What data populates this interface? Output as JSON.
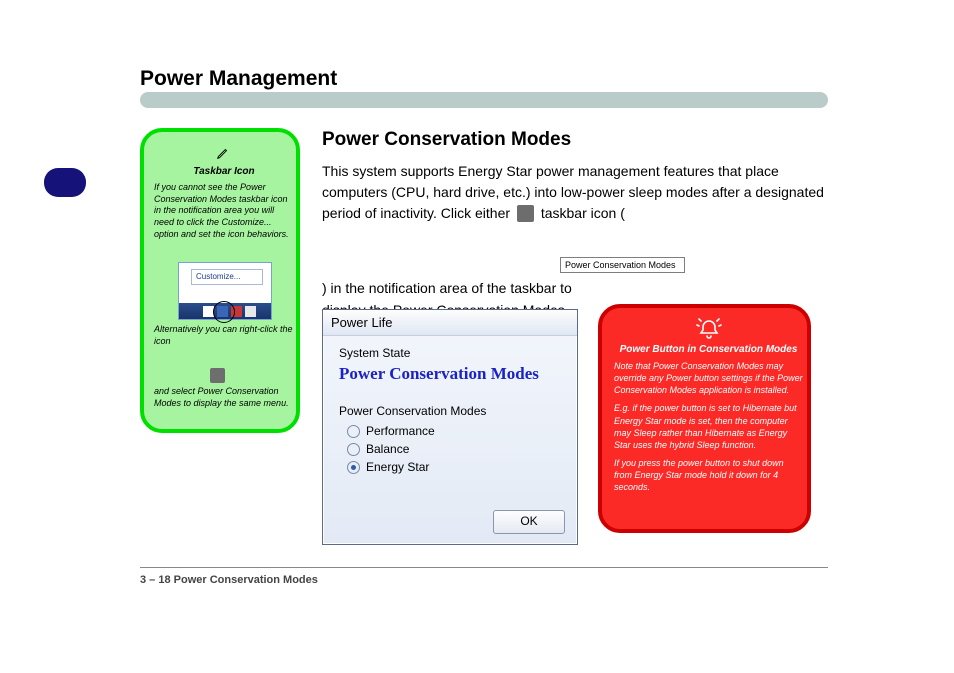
{
  "section_title": "Power Management",
  "green_box": {
    "title": "Taskbar Icon",
    "para1": "If you cannot see the Power Conservation Modes taskbar icon in the notification area you will need to click the Customize... option and set the icon behaviors.",
    "customize_label": "Customize...",
    "para2": "Alternatively you can right-click the icon",
    "para3": "and select Power Conservation Modes to display the same menu."
  },
  "heading": "Power Conservation Modes",
  "paragraph1_before_icon": "This system supports Energy Star power management features that place computers (CPU, hard drive, etc.) into low-power sleep modes after a designated period of inactivity. Click either ",
  "paragraph1_after_icon": " taskbar icon (",
  "paragraph1_after_tooltip": ") in the notification area of the taskbar to display the Power Conservation Modes menu.",
  "tooltip": "Power Conservation Modes",
  "dialog": {
    "title": "Power Life",
    "system_state": "System State",
    "mode_heading": "Power Conservation Modes",
    "group_label": "Power Conservation Modes",
    "options": [
      "Performance",
      "Balance",
      "Energy Star"
    ],
    "selected_index": 2,
    "ok_label": "OK"
  },
  "red_box": {
    "title": "Power Button in Conservation Modes",
    "p1": "Note that Power Conservation Modes may override any Power button settings if the Power Conservation Modes application is installed.",
    "p2": "E.g. if the power button is set to Hibernate but Energy Star mode is set, then the computer may Sleep rather than Hibernate as Energy Star uses the hybrid Sleep function.",
    "p3": "If you press the power button to shut down from Energy Star mode hold it down for 4 seconds."
  },
  "footer_left": "3 – 18  Power Conservation Modes"
}
